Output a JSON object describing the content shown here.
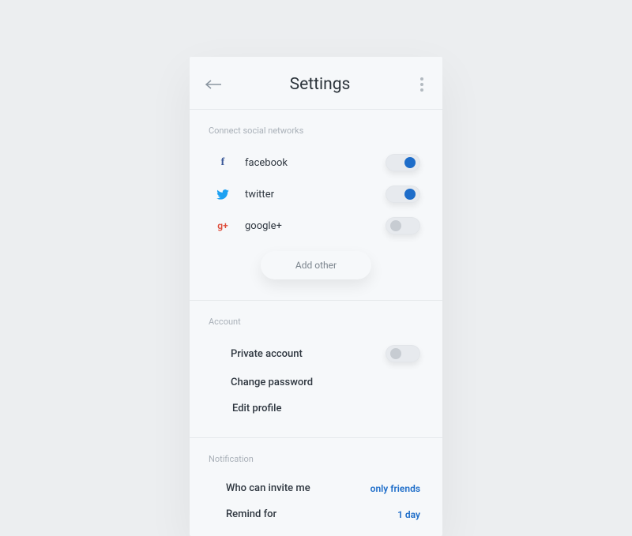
{
  "header": {
    "title": "Settings"
  },
  "sections": {
    "social": {
      "label": "Connect social networks",
      "items": [
        {
          "label": "facebook",
          "on": true
        },
        {
          "label": "twitter",
          "on": true
        },
        {
          "label": "google+",
          "on": false
        }
      ],
      "add_button": "Add other"
    },
    "account": {
      "label": "Account",
      "items": [
        {
          "label": "Private account",
          "toggle": true,
          "on": false
        },
        {
          "label": "Change password"
        },
        {
          "label": "Edit profile"
        }
      ]
    },
    "notification": {
      "label": "Notification",
      "items": [
        {
          "label": "Who can invite me",
          "value": "only friends"
        },
        {
          "label": "Remind for",
          "value": "1 day"
        }
      ]
    }
  }
}
